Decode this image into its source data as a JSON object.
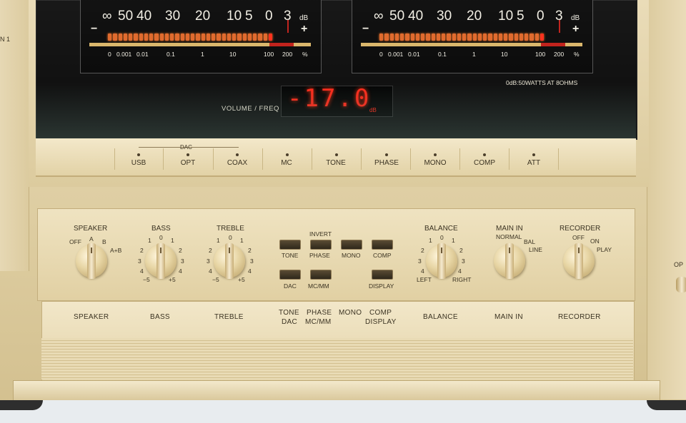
{
  "meters": {
    "scale_top": [
      "∞",
      "50",
      "40",
      "30",
      "20",
      "10",
      "5",
      "0",
      "3"
    ],
    "db_unit": "dB",
    "minus": "−",
    "plus": "+",
    "scale_bottom": [
      "0",
      "0.001",
      "0.01",
      "0.1",
      "1",
      "10",
      "100",
      "200",
      "%"
    ]
  },
  "display": {
    "label": "VOLUME / FREQ",
    "value": "-17.0",
    "unit": "dB",
    "rated": "0dB:50WATTS AT 8OHMS"
  },
  "indicators": {
    "group_label": "DAC",
    "items": [
      "USB",
      "OPT",
      "COAX",
      "MC",
      "TONE",
      "PHASE",
      "MONO",
      "COMP",
      "ATT"
    ]
  },
  "controls": {
    "speaker": {
      "title": "SPEAKER",
      "off": "OFF",
      "a": "A",
      "b": "B",
      "ab": "A+B"
    },
    "bass": {
      "title": "BASS",
      "marks": [
        "1",
        "0",
        "1",
        "2",
        "2",
        "3",
        "3",
        "4",
        "4",
        "−5",
        "+5"
      ]
    },
    "treble": {
      "title": "TREBLE",
      "marks": [
        "1",
        "0",
        "1",
        "2",
        "2",
        "3",
        "3",
        "4",
        "4",
        "−5",
        "+5"
      ]
    },
    "buttons": {
      "invert": "INVERT",
      "tone": "TONE",
      "phase": "PHASE",
      "mono": "MONO",
      "comp": "COMP",
      "dac": "DAC",
      "mcmm": "MC/MM",
      "display": "DISPLAY"
    },
    "balance": {
      "title": "BALANCE",
      "marks": [
        "1",
        "0",
        "1",
        "2",
        "2",
        "3",
        "3",
        "4",
        "4"
      ],
      "left": "LEFT",
      "right": "RIGHT"
    },
    "main_in": {
      "title": "MAIN IN",
      "normal": "NORMAL",
      "bal": "BAL",
      "line": "LINE"
    },
    "recorder": {
      "title": "RECORDER",
      "off": "OFF",
      "on": "ON",
      "play": "PLAY"
    }
  },
  "flap": {
    "speaker": "SPEAKER",
    "bass": "BASS",
    "treble": "TREBLE",
    "tone": "TONE",
    "phase": "PHASE",
    "mono": "MONO",
    "comp": "COMP",
    "dac": "DAC",
    "mcmm": "MC/MM",
    "display": "DISPLAY",
    "balance": "BALANCE",
    "main_in": "MAIN IN",
    "recorder": "RECORDER"
  },
  "side": {
    "left": "N 1",
    "right": "OP"
  }
}
